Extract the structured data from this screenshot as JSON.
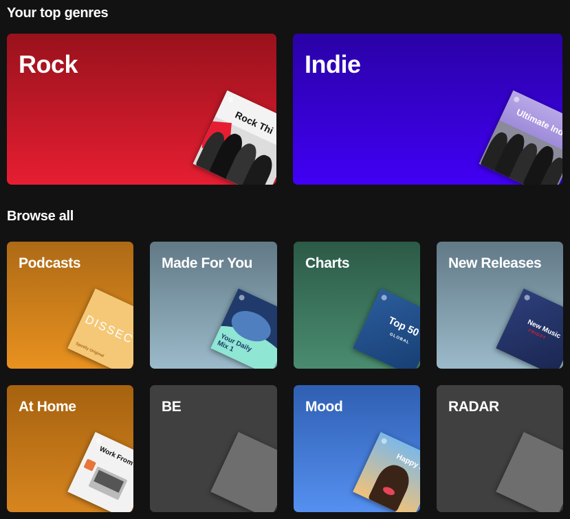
{
  "sections": {
    "top_genres": "Your top genres",
    "browse_all": "Browse all"
  },
  "top_genres": [
    {
      "label": "Rock",
      "color_top": "#98121c",
      "color_bottom": "#e61e32",
      "cover_text": "Rock Thi"
    },
    {
      "label": "Indie",
      "color_top": "#2a02a6",
      "color_bottom": "#4100f4",
      "cover_text": "Ultimate Indi"
    }
  ],
  "browse": [
    {
      "label": "Podcasts",
      "color": "#e8911f",
      "cover_text": "DISSECT",
      "cover_subtext": "Spotify Original"
    },
    {
      "label": "Made For You",
      "color": "#92aab8",
      "cover_text": "Your Daily Mix 1"
    },
    {
      "label": "Charts",
      "color": "#3f7d63",
      "cover_text": "Top 50",
      "cover_subtext": "GLOBAL"
    },
    {
      "label": "New Releases",
      "color": "#92aab8",
      "cover_text": "New Music",
      "cover_subtext": "FRIDAY"
    },
    {
      "label": "At Home",
      "color": "#d7851f",
      "cover_text": "Work From Ho"
    },
    {
      "label": "BE",
      "color": "#404040"
    },
    {
      "label": "Mood",
      "color": "#477ad6",
      "cover_text": "Happy Hits"
    },
    {
      "label": "RADAR",
      "color": "#404040"
    }
  ]
}
